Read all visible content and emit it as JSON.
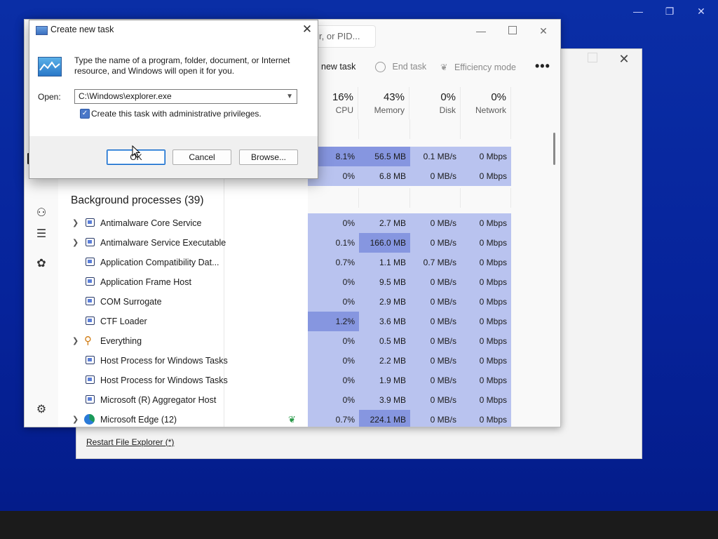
{
  "desktop": {
    "win_min": "—",
    "win_max": "❐",
    "win_close": "✕"
  },
  "back_window": {
    "restart_link": "Restart File Explorer (*)",
    "close": "✕"
  },
  "task_manager": {
    "search_placeholder": "r, or PID...",
    "toolbar": {
      "run_new_task": "new task",
      "end_task": "End task",
      "efficiency_mode": "Efficiency mode",
      "more": "•••"
    },
    "win_min": "—",
    "win_close": "✕",
    "columns": [
      {
        "pct": "16%",
        "label": "CPU"
      },
      {
        "pct": "43%",
        "label": "Memory"
      },
      {
        "pct": "0%",
        "label": "Disk"
      },
      {
        "pct": "0%",
        "label": "Network"
      }
    ],
    "section_title": "Background processes (39)",
    "top_rows": [
      {
        "cpu": "8.1%",
        "mem": "56.5 MB",
        "disk": "0.1 MB/s",
        "net": "0 Mbps"
      },
      {
        "cpu": "0%",
        "mem": "6.8 MB",
        "disk": "0 MB/s",
        "net": "0 Mbps"
      }
    ],
    "processes": [
      {
        "name": "Antimalware Core Service",
        "cpu": "0%",
        "mem": "2.7 MB",
        "disk": "0 MB/s",
        "net": "0 Mbps"
      },
      {
        "name": "Antimalware Service Executable",
        "cpu": "0.1%",
        "mem": "166.0 MB",
        "disk": "0 MB/s",
        "net": "0 Mbps"
      },
      {
        "name": "Application Compatibility Dat...",
        "cpu": "0.7%",
        "mem": "1.1 MB",
        "disk": "0.7 MB/s",
        "net": "0 Mbps"
      },
      {
        "name": "Application Frame Host",
        "cpu": "0%",
        "mem": "9.5 MB",
        "disk": "0 MB/s",
        "net": "0 Mbps"
      },
      {
        "name": "COM Surrogate",
        "cpu": "0%",
        "mem": "2.9 MB",
        "disk": "0 MB/s",
        "net": "0 Mbps"
      },
      {
        "name": "CTF Loader",
        "cpu": "1.2%",
        "mem": "3.6 MB",
        "disk": "0 MB/s",
        "net": "0 Mbps"
      },
      {
        "name": "Everything",
        "cpu": "0%",
        "mem": "0.5 MB",
        "disk": "0 MB/s",
        "net": "0 Mbps"
      },
      {
        "name": "Host Process for Windows Tasks",
        "cpu": "0%",
        "mem": "2.2 MB",
        "disk": "0 MB/s",
        "net": "0 Mbps"
      },
      {
        "name": "Host Process for Windows Tasks",
        "cpu": "0%",
        "mem": "1.9 MB",
        "disk": "0 MB/s",
        "net": "0 Mbps"
      },
      {
        "name": "Microsoft (R) Aggregator Host",
        "cpu": "0%",
        "mem": "3.9 MB",
        "disk": "0 MB/s",
        "net": "0 Mbps"
      },
      {
        "name": "Microsoft Edge (12)",
        "cpu": "0.7%",
        "mem": "224.1 MB",
        "disk": "0 MB/s",
        "net": "0 Mbps"
      }
    ]
  },
  "dialog": {
    "title": "Create new task",
    "close": "✕",
    "description": "Type the name of a program, folder, document, or Internet resource, and Windows will open it for you.",
    "open_label": "Open:",
    "open_value": "C:\\Windows\\explorer.exe",
    "admin_checkbox_label": "Create this task with administrative privileges.",
    "admin_checked": true,
    "ok": "OK",
    "cancel": "Cancel",
    "browse": "Browse..."
  }
}
